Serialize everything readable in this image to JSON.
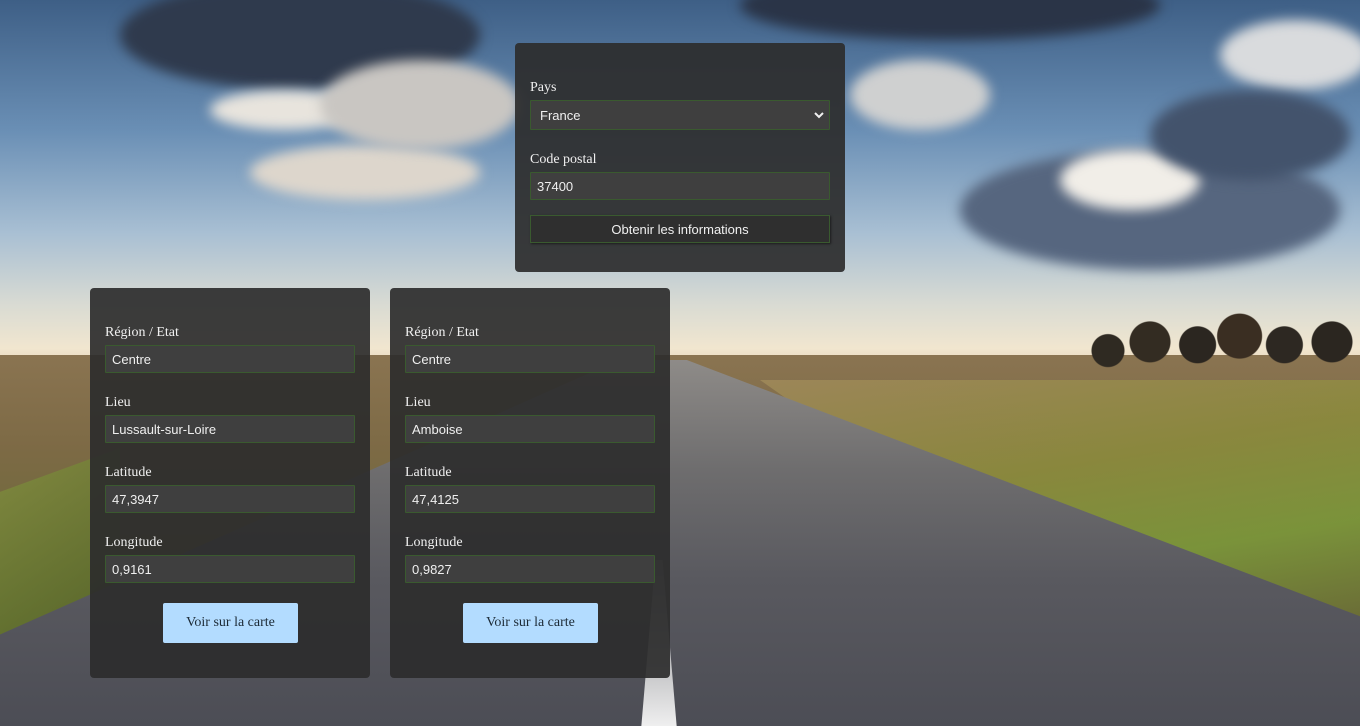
{
  "search": {
    "country_label": "Pays",
    "country_value": "France",
    "postal_label": "Code postal",
    "postal_value": "37400",
    "submit_label": "Obtenir les informations"
  },
  "results": [
    {
      "region_label": "Région / Etat",
      "region_value": "Centre",
      "place_label": "Lieu",
      "place_value": "Lussault-sur-Loire",
      "lat_label": "Latitude",
      "lat_value": "47,3947",
      "lon_label": "Longitude",
      "lon_value": "0,9161",
      "map_button_label": "Voir sur la carte"
    },
    {
      "region_label": "Région / Etat",
      "region_value": "Centre",
      "place_label": "Lieu",
      "place_value": "Amboise",
      "lat_label": "Latitude",
      "lat_value": "47,4125",
      "lon_label": "Longitude",
      "lon_value": "0,9827",
      "map_button_label": "Voir sur la carte"
    }
  ],
  "icons": {
    "select_chevron": "chevron-down-icon"
  },
  "colors": {
    "panel_bg": "#2c2c2c",
    "field_bg": "#3f3f3f",
    "field_border": "#3a5a2f",
    "map_button_bg": "#b3dcff",
    "text": "#f0f0f0"
  }
}
